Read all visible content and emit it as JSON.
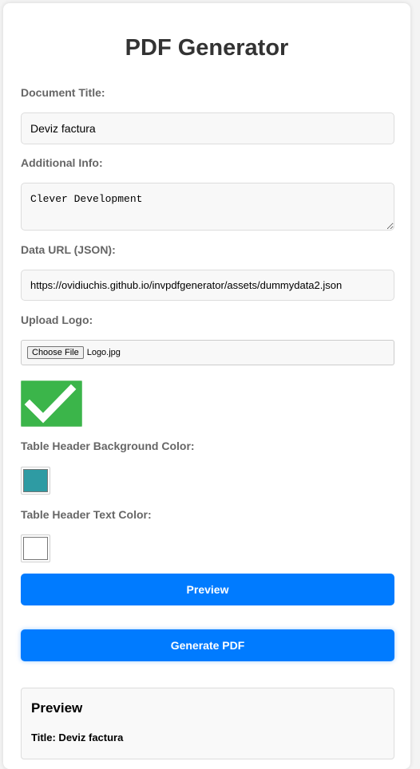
{
  "page": {
    "title": "PDF Generator"
  },
  "form": {
    "document_title": {
      "label": "Document Title:",
      "value": "Deviz factura"
    },
    "additional_info": {
      "label": "Additional Info:",
      "value": "Clever Development"
    },
    "data_url": {
      "label": "Data URL (JSON):",
      "value": "https://ovidiuchis.github.io/invpdfgenerator/assets/dummydata2.json"
    },
    "upload_logo": {
      "label": "Upload Logo:",
      "button_label": "Choose File",
      "file_name": "Logo.jpg",
      "preview_icon": "green-checkmark-icon"
    },
    "header_bg_color": {
      "label": "Table Header Background Color:",
      "value": "#2e9ba3"
    },
    "header_text_color": {
      "label": "Table Header Text Color:",
      "value": "#ffffff"
    }
  },
  "actions": {
    "preview_label": "Preview",
    "generate_label": "Generate PDF",
    "button_color": "#007bff"
  },
  "preview": {
    "heading": "Preview",
    "title_line": "Title: Deviz factura"
  }
}
